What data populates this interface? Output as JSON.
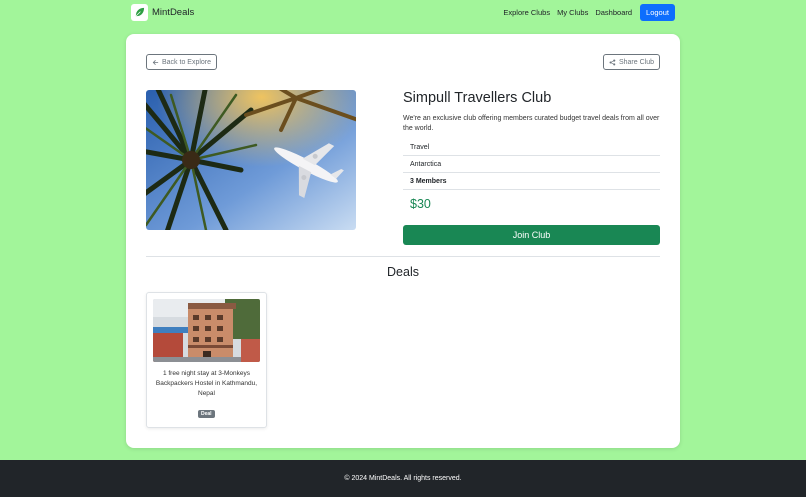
{
  "brand": {
    "name": "MintDeals",
    "logo_icon": "leaf-icon"
  },
  "nav": {
    "links": [
      "Explore Clubs",
      "My Clubs",
      "Dashboard"
    ],
    "logout": "Logout",
    "logout_color": "#0d6efd"
  },
  "actions": {
    "back": "Back to Explore",
    "share": "Share Club"
  },
  "club": {
    "name": "Simpull Travellers Club",
    "description": "We're an exclusive club offering members curated budget travel deals from all over the world.",
    "category": "Travel",
    "location": "Antarctica",
    "members": "3 Members",
    "price": "$30",
    "join_label": "Join Club",
    "accent_color": "#198754"
  },
  "deals": {
    "heading": "Deals",
    "items": [
      {
        "title": "1 free night stay at 3-Monkeys Backpackers Hostel in Kathmandu, Nepal",
        "badge": "Deal"
      }
    ]
  },
  "footer": {
    "text": "© 2024 MintDeals. All rights reserved."
  },
  "colors": {
    "page_bg": "#a2f59a",
    "footer_bg": "#212529"
  }
}
